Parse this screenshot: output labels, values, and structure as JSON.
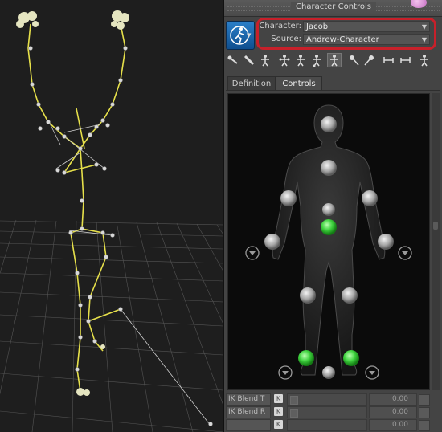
{
  "window": {
    "title": "Character Controls"
  },
  "character": {
    "character_label": "Character:",
    "character_value": "Jacob",
    "source_label": "Source:",
    "source_value": "Andrew-Character"
  },
  "toolbar": {
    "icons": [
      "bones-icon",
      "stick-icon",
      "stand-pose-icon",
      "full-body-icon",
      "body-part-icon",
      "body-all-icon",
      "body-part-2-icon",
      "pin-icon",
      "pin-2-icon",
      "key-left-icon",
      "key-right-icon",
      "pin-3-icon"
    ]
  },
  "tabs": [
    {
      "label": "Definition",
      "active": false
    },
    {
      "label": "Controls",
      "active": true
    }
  ],
  "ik_rows": [
    {
      "label": "IK Blend T",
      "key": "K",
      "value": "0.00"
    },
    {
      "label": "IK Blend R",
      "key": "K",
      "value": "0.00"
    },
    {
      "label": "",
      "key": "K",
      "value": "0.00"
    }
  ],
  "colors": {
    "highlight": "#c8202a",
    "active_effector": "#3fd23f",
    "effector": "#b8b8b8",
    "skeleton": "#e6e04a"
  }
}
